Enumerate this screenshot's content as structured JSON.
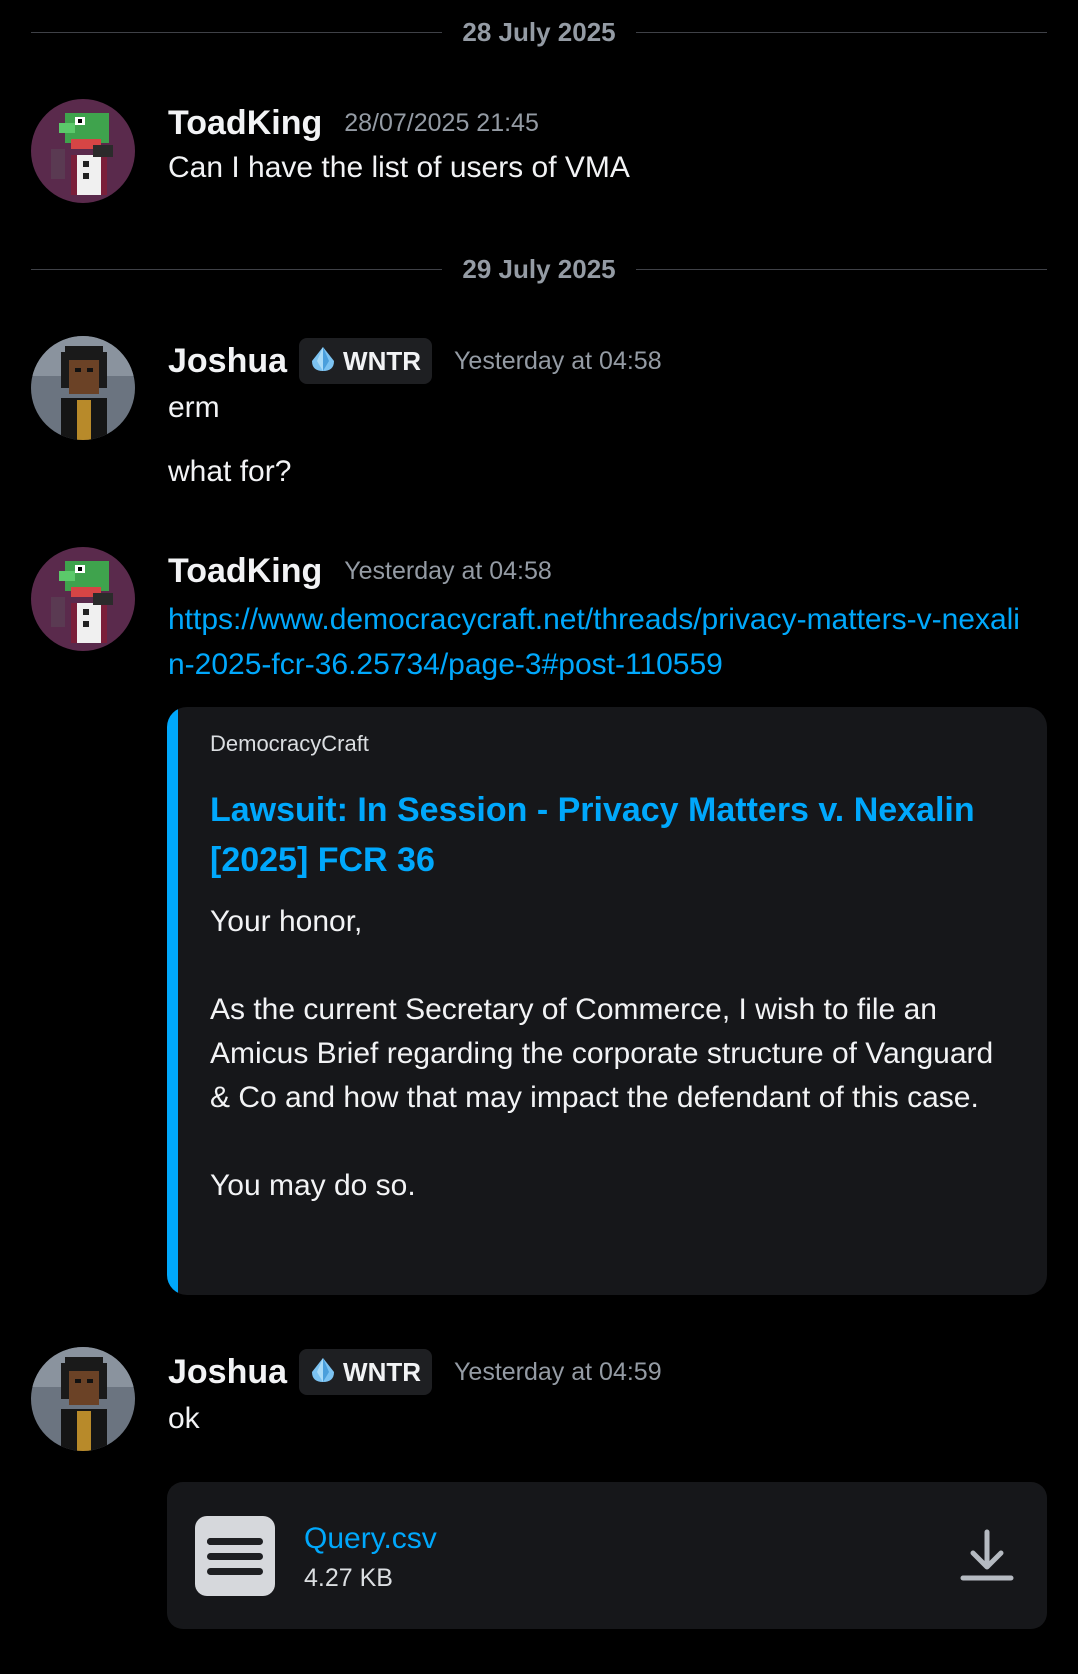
{
  "dividers": [
    {
      "label": "28 July 2025"
    },
    {
      "label": "29 July 2025"
    }
  ],
  "messages": [
    {
      "username": "ToadKing",
      "timestamp": "28/07/2025 21:45",
      "lines": [
        "Can I have the list of users of VMA"
      ]
    },
    {
      "username": "Joshua",
      "tag": "WNTR",
      "timestamp": "Yesterday at 04:58",
      "lines": [
        "erm",
        "what for?"
      ]
    },
    {
      "username": "ToadKing",
      "timestamp": "Yesterday at 04:58",
      "link": "https://www.democracycraft.net/threads/privacy-matters-v-nexalin-2025-fcr-36.25734/page-3#post-110559",
      "embed": {
        "provider": "DemocracyCraft",
        "title": "Lawsuit: In Session - Privacy Matters v. Nexalin [2025] FCR 36",
        "paragraphs": [
          "Your honor,",
          "As the current Secretary of Commerce, I wish to file an Amicus Brief regarding the corporate structure of Vanguard & Co and how that may impact the defendant of this case.",
          "You may do so."
        ]
      }
    },
    {
      "username": "Joshua",
      "tag": "WNTR",
      "timestamp": "Yesterday at 04:59",
      "lines": [
        "ok"
      ],
      "attachment": {
        "name": "Query.csv",
        "size": "4.27 KB"
      }
    }
  ],
  "colors": {
    "background": "#000000",
    "link": "#00a8fc",
    "muted": "#949ba4",
    "embed_bg": "#16171a"
  },
  "icons": {
    "tag": "crystal-icon",
    "file": "document-icon",
    "download": "download-icon"
  }
}
